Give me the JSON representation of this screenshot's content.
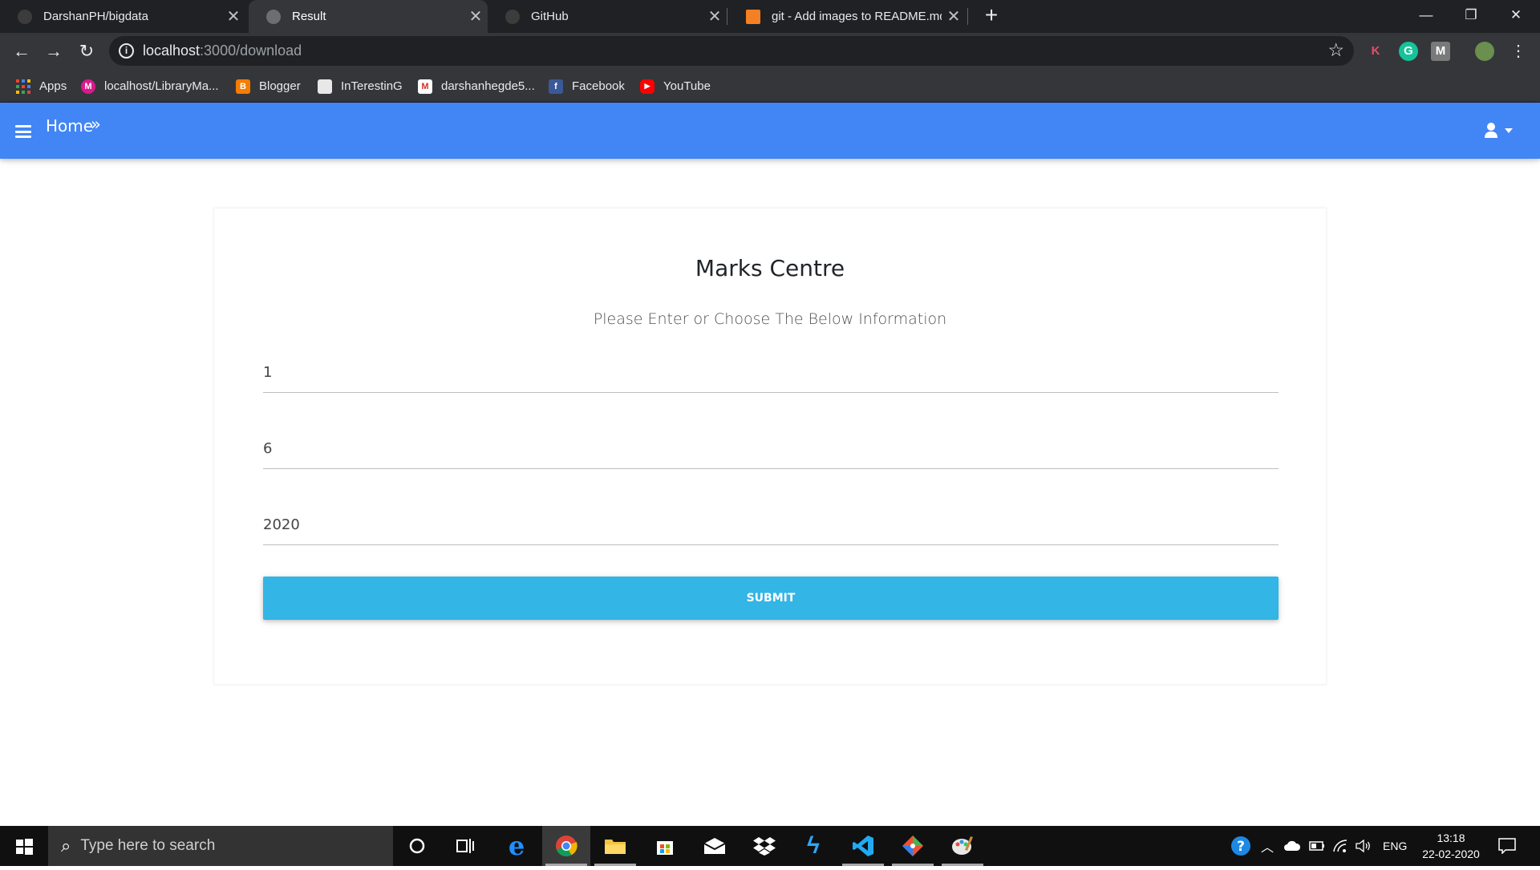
{
  "browser": {
    "tabs": [
      {
        "title": "DarshanPH/bigdata",
        "active": false,
        "icon": "github-icon"
      },
      {
        "title": "Result",
        "active": true,
        "icon": "globe-icon"
      },
      {
        "title": "GitHub",
        "active": false,
        "icon": "github-icon"
      },
      {
        "title": "git - Add images to README.md",
        "active": false,
        "icon": "stackoverflow-icon"
      }
    ],
    "address": {
      "host": "localhost",
      "path": ":3000/download"
    },
    "bookmarks": [
      {
        "label": "Apps",
        "icon": "apps-grid-icon"
      },
      {
        "label": "localhost/LibraryMa...",
        "icon": "library-icon"
      },
      {
        "label": "Blogger",
        "icon": "blogger-icon"
      },
      {
        "label": "InTerestinG",
        "icon": "interesting-icon"
      },
      {
        "label": "darshanhegde5...",
        "icon": "gmail-icon"
      },
      {
        "label": "Facebook",
        "icon": "facebook-icon"
      },
      {
        "label": "YouTube",
        "icon": "youtube-icon"
      }
    ],
    "extensions": [
      "K",
      "G",
      "M"
    ]
  },
  "appbar": {
    "breadcrumb": "Home",
    "breadcrumb_separator": "»",
    "color": "#4285f4"
  },
  "form": {
    "title": "Marks Centre",
    "subtitle": "Please Enter or Choose The Below Information",
    "fields": [
      {
        "value": "1"
      },
      {
        "value": "6"
      },
      {
        "value": "2020"
      }
    ],
    "submit_label": "SUBMIT",
    "submit_color": "#33b5e5"
  },
  "taskbar": {
    "search_placeholder": "Type here to search",
    "language": "ENG",
    "time": "13:18",
    "date": "22-02-2020"
  }
}
